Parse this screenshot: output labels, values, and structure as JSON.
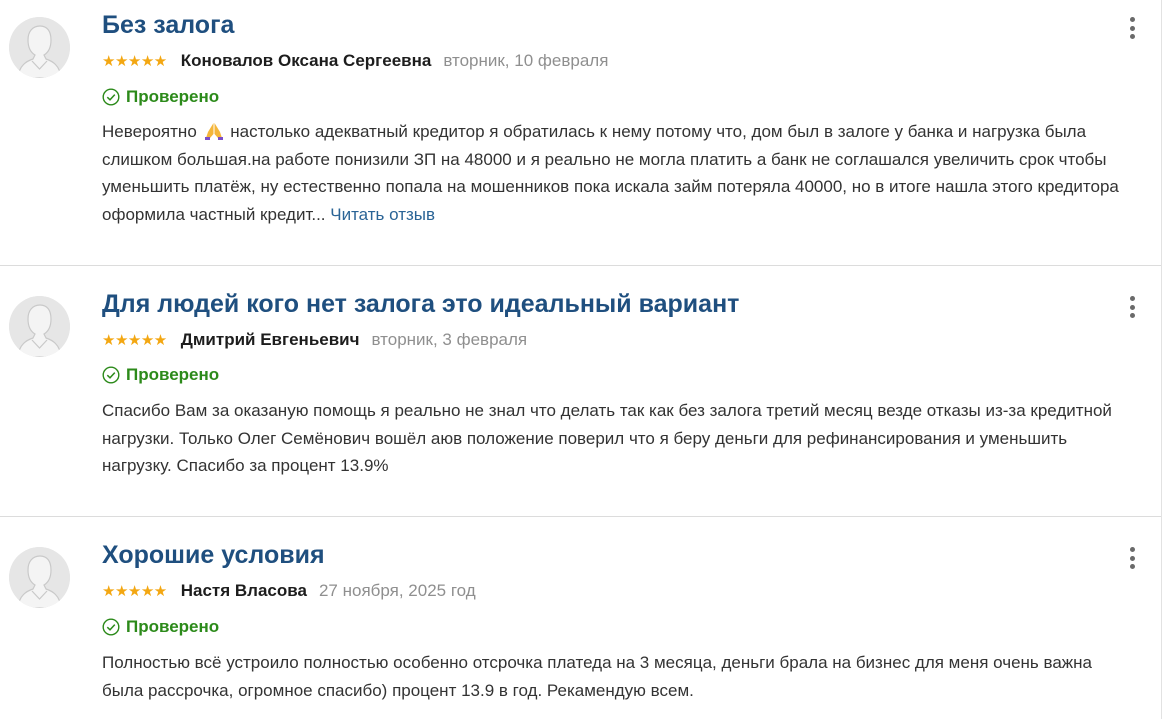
{
  "reviews": [
    {
      "title": "Без залога",
      "stars": "★★★★★",
      "rating": 5,
      "author": "Коновалов Оксана Сергеевна",
      "date": "вторник, 10 февраля",
      "verified": "Проверено",
      "text_before_emoji": "Невероятно",
      "emoji": "folded-hands-icon",
      "text_after_emoji": "настолько адекватный кредитор я обратилась к нему потому что, дом был в залоге у банка и нагрузка была слишком большая.на работе понизили ЗП на 48000 и я реально не могла платить а банк не соглашался увеличить срок чтобы уменьшить платёж, ну естественно попала на мошенников пока искала займ потеряла 40000, но в итоге нашла этого кредитора оформила частный кредит...",
      "read_more": "Читать отзыв"
    },
    {
      "title": "Для людей кого нет залога это идеальный вариант",
      "stars": "★★★★★",
      "rating": 5,
      "author": "Дмитрий Евгеньевич",
      "date": "вторник, 3 февраля",
      "verified": "Проверено",
      "text": "Спасибо Вам за оказаную помощь я реально не знал что делать так как без залога третий месяц везде отказы из-за кредитной нагрузки. Только Олег Семёнович вошёл аюв положение поверил что я беру деньги для рефинансирования и уменьшить нагрузку. Спасибо за процент 13.9%"
    },
    {
      "title": "Хорошие условия",
      "stars": "★★★★★",
      "rating": 5,
      "author": "Настя Власова",
      "date": "27 ноября, 2025 год",
      "verified": "Проверено",
      "text": "Полностью всё устроило полностью особенно отсрочка платеда на 3 месяца, деньги брала на бизнес для меня очень важна была рассрочка, огромное спасибо) процент 13.9 в год. Рекамендую всем."
    }
  ],
  "colors": {
    "title": "#1f4f7f",
    "stars": "#f3a712",
    "verified": "#2c8a1a",
    "link": "#2a6496",
    "date": "#8f8f8f"
  }
}
